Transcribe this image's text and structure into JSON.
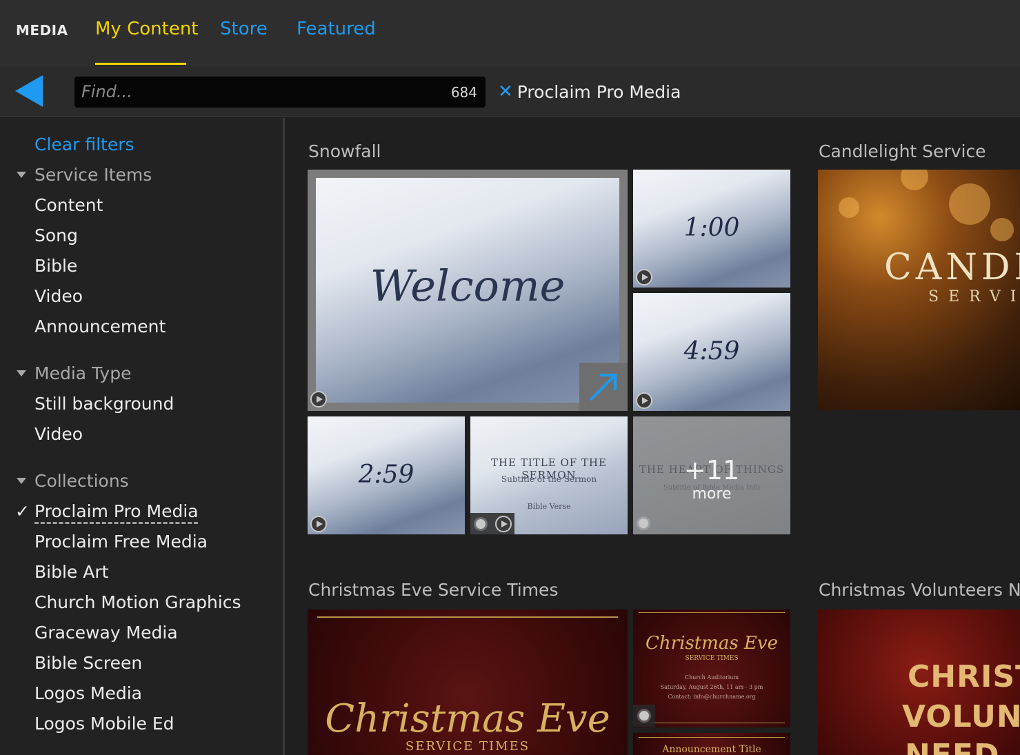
{
  "header": {
    "app_title": "MEDIA",
    "tabs": [
      {
        "label": "My Content",
        "active": true
      },
      {
        "label": "Store",
        "active": false
      },
      {
        "label": "Featured",
        "active": false
      }
    ],
    "accent_color": "#1e9bf0",
    "active_color": "#f2d300"
  },
  "search": {
    "placeholder": "Find...",
    "value": "",
    "result_count": "684",
    "active_filter": "Proclaim Pro Media"
  },
  "sidebar": {
    "clear_filters": "Clear filters",
    "service_items": {
      "heading": "Service Items",
      "items": [
        "Content",
        "Song",
        "Bible",
        "Video",
        "Announcement"
      ]
    },
    "media_type": {
      "heading": "Media Type",
      "items": [
        "Still background",
        "Video"
      ]
    },
    "collections": {
      "heading": "Collections",
      "items": [
        "Proclaim Pro Media",
        "Proclaim Free Media",
        "Bible Art",
        "Church Motion Graphics",
        "Graceway Media",
        "Bible Screen",
        "Logos Media",
        "Logos Mobile Ed"
      ],
      "checked": "Proclaim Pro Media"
    }
  },
  "groups": [
    {
      "title": "Snowfall",
      "thumbs": [
        {
          "text": "Welcome"
        },
        {
          "text": "1:00"
        },
        {
          "text": "4:59"
        },
        {
          "text": "2:59"
        },
        {
          "text": "THE TITLE OF THE SERMON",
          "subtitle": "Subtitle of the Sermon",
          "footer": "Bible Verse"
        },
        {
          "text": "THE HEART OF THINGS",
          "subtitle": "Subtitle of Bible Media Info",
          "more_count": "+11",
          "more_label": "more"
        }
      ]
    },
    {
      "title": "Candlelight Service",
      "thumbs": [
        {
          "text": "CANDLELI",
          "subtitle": "SERVIC"
        }
      ]
    },
    {
      "title": "Christmas Eve Service Times",
      "thumbs": [
        {
          "text": "Christmas Eve",
          "subtitle": "SERVICE TIMES"
        },
        {
          "text": "Christmas Eve",
          "subtitle": "SERVICE TIMES",
          "line1": "Church Auditorium",
          "line2": "Saturday, August 26th, 11 am - 3 pm",
          "line3": "Contact: info@churchname.org"
        },
        {
          "text": "Announcement Title"
        }
      ]
    },
    {
      "title": "Christmas Volunteers Ne",
      "thumbs": [
        {
          "text": "CHRISTMA",
          "subtitle": "VOLUNTEE",
          "line1": "NEED"
        }
      ]
    }
  ],
  "icons": {
    "back": "back-arrow-icon",
    "clear_filter": "close-icon",
    "play": "play-icon",
    "still": "sun-icon",
    "expand": "expand-arrow-icon",
    "collapse": "triangle-down-icon",
    "check": "checkmark-icon"
  }
}
